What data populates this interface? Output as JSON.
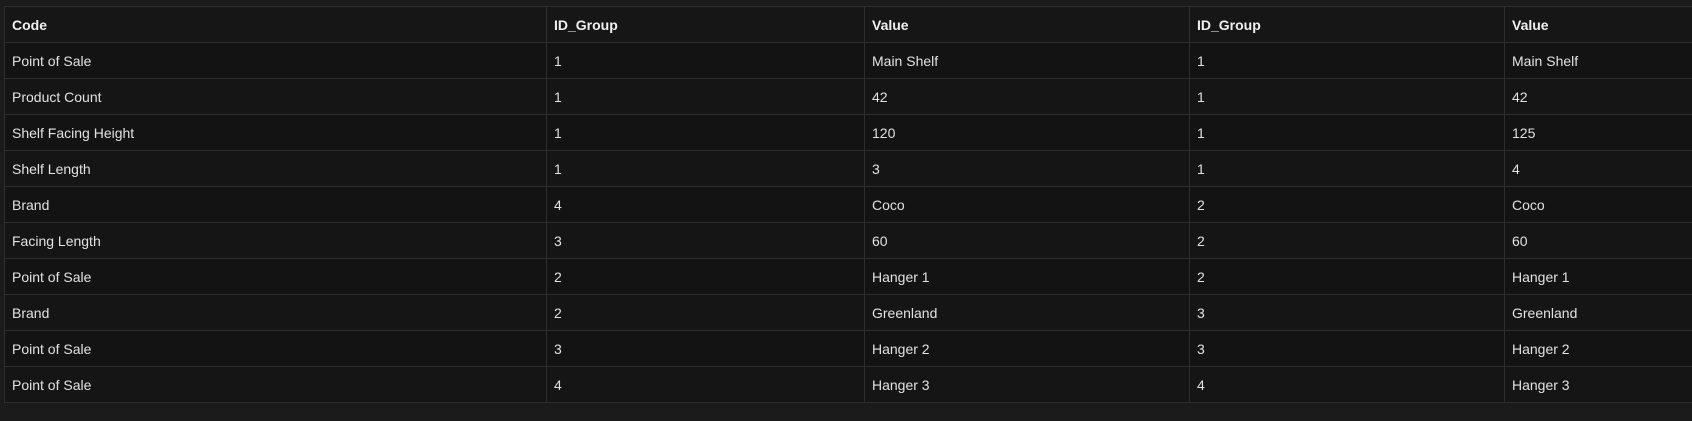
{
  "table": {
    "headers": [
      "Code",
      "ID_Group",
      "Value",
      "ID_Group",
      "Value"
    ],
    "rows": [
      [
        "Point of Sale",
        "1",
        "Main Shelf",
        "1",
        "Main Shelf"
      ],
      [
        "Product Count",
        "1",
        "42",
        "1",
        "42"
      ],
      [
        "Shelf Facing Height",
        "1",
        "120",
        "1",
        "125"
      ],
      [
        "Shelf Length",
        "1",
        "3",
        "1",
        "4"
      ],
      [
        "Brand",
        "4",
        "Coco",
        "2",
        "Coco"
      ],
      [
        "Facing Length",
        "3",
        "60",
        "2",
        "60"
      ],
      [
        "Point of Sale",
        "2",
        "Hanger 1",
        "2",
        "Hanger 1"
      ],
      [
        "Brand",
        "2",
        "Greenland",
        "3",
        "Greenland"
      ],
      [
        "Point of Sale",
        "3",
        "Hanger 2",
        "3",
        "Hanger 2"
      ],
      [
        "Point of Sale",
        "4",
        "Hanger 3",
        "4",
        "Hanger 3"
      ]
    ]
  },
  "colors": {
    "background": "#1b1b1b",
    "cell_background": "#141414",
    "border": "#2e2e2e",
    "text": "#e2e2e2"
  }
}
